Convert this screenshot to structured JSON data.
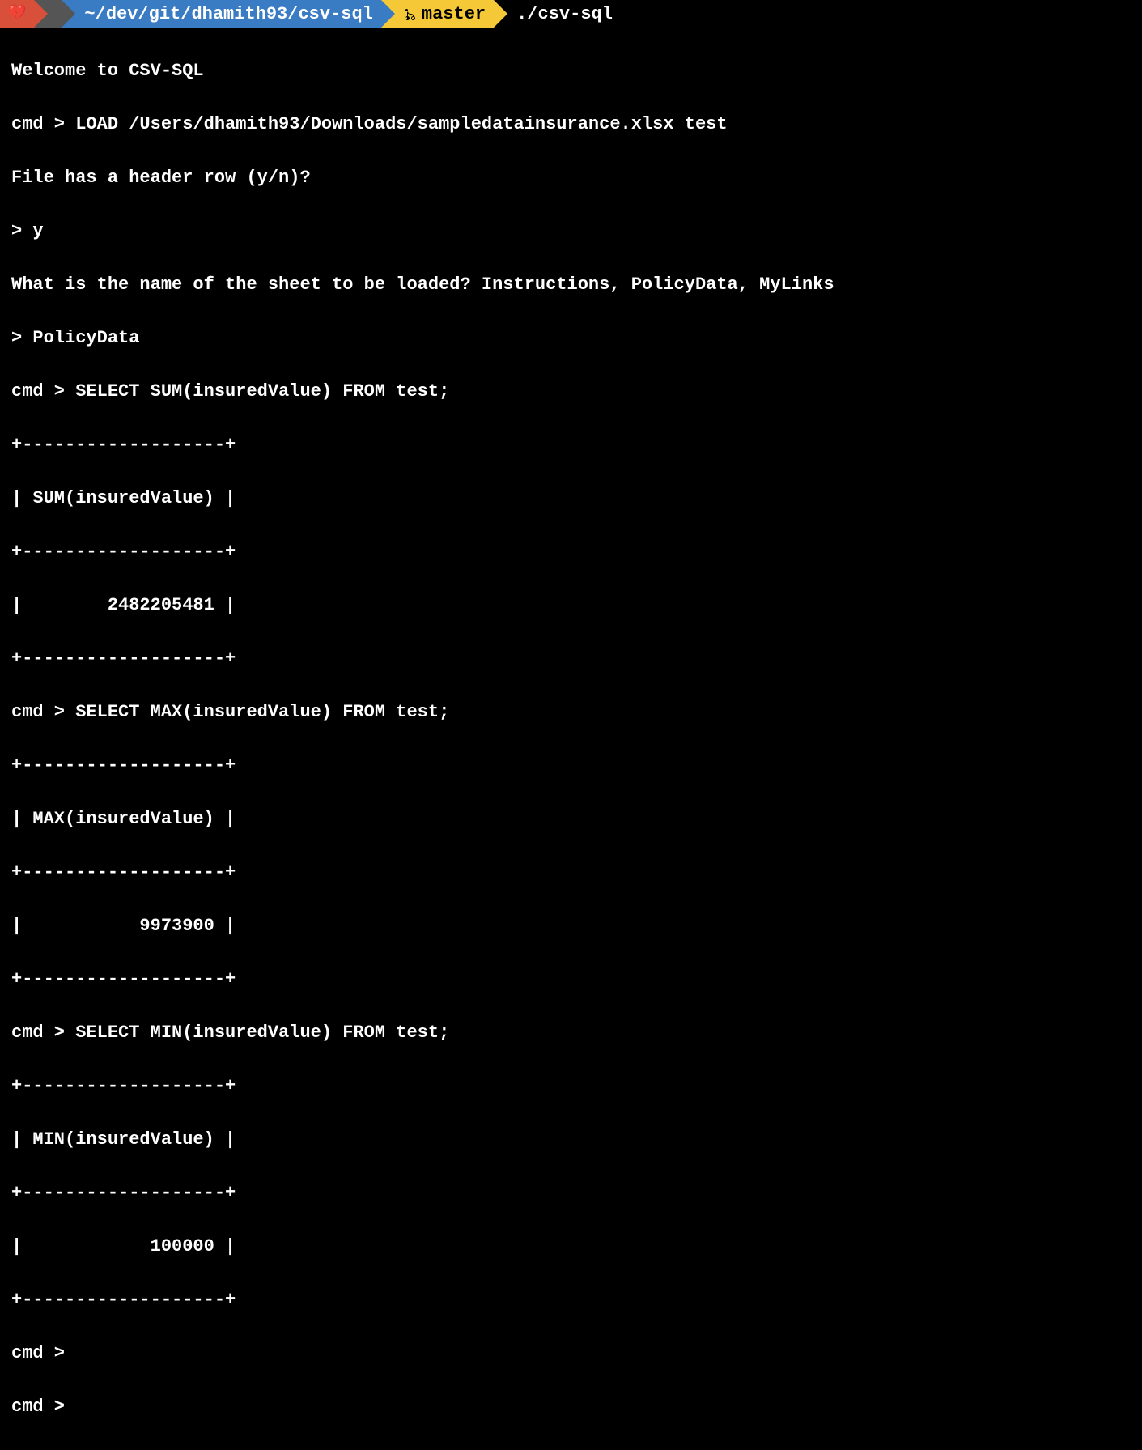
{
  "prompt": {
    "path": "~/dev/git/dhamith93/csv-sql",
    "branch": "master",
    "command": "./csv-sql"
  },
  "session": {
    "welcome": "Welcome to CSV-SQL",
    "load_cmd": "cmd > LOAD /Users/dhamith93/Downloads/sampledatainsurance.xlsx test",
    "header_prompt": "File has a header row (y/n)?",
    "header_answer": "> y",
    "sheet_prompt": "What is the name of the sheet to be loaded? Instructions, PolicyData, MyLinks",
    "sheet_answer": "> PolicyData",
    "queries": [
      {
        "cmd": "cmd > SELECT SUM(insuredValue) FROM test;",
        "sep": "+-------------------+",
        "header": "| SUM(insuredValue) |",
        "value": "|        2482205481 |"
      },
      {
        "cmd": "cmd > SELECT MAX(insuredValue) FROM test;",
        "sep": "+-------------------+",
        "header": "| MAX(insuredValue) |",
        "value": "|           9973900 |"
      },
      {
        "cmd": "cmd > SELECT MIN(insuredValue) FROM test;",
        "sep": "+-------------------+",
        "header": "| MIN(insuredValue) |",
        "value": "|            100000 |"
      }
    ],
    "empty_prompt1": "cmd >",
    "empty_prompt2": "cmd > "
  }
}
